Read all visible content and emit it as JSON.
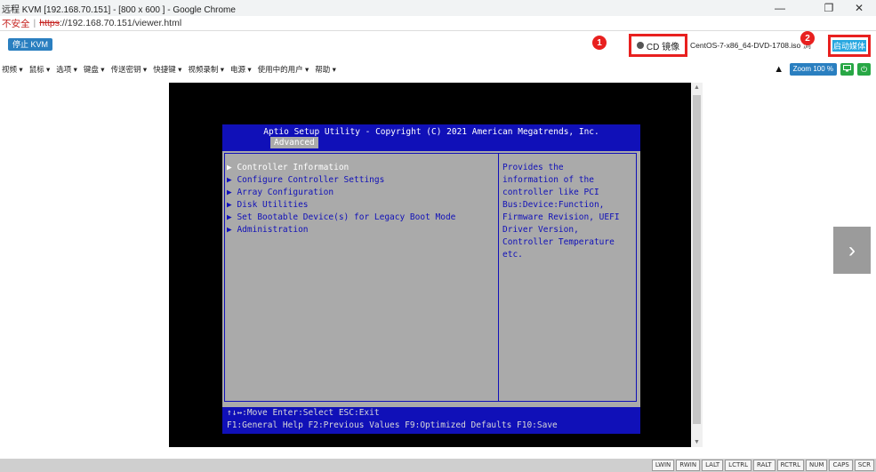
{
  "window": {
    "title": "远程 KVM [192.168.70.151] - [800 x 600 ] - Google Chrome",
    "minimize": "—",
    "maximize": "❐",
    "close": "✕"
  },
  "address": {
    "insecure": "不安全",
    "separator": "|",
    "scheme": "https",
    "rest": "://192.168.70.151/viewer.html"
  },
  "kvm_toolbar": {
    "stop_kvm": "停止 KVM",
    "cd_label": "CD 镜像",
    "iso_file": "CentOS-7-x86_64-DVD-1708.iso",
    "iso_tail": "浏",
    "start_media": "启动媒体",
    "badge_1": "1",
    "badge_2": "2"
  },
  "menu": {
    "items": [
      "视频 ▾",
      "鼠标 ▾",
      "选项 ▾",
      "键盘 ▾",
      "传送密钥 ▾",
      "快捷键 ▾",
      "视频录制 ▾",
      "电源 ▾",
      "使用中的用户 ▾",
      "帮助 ▾"
    ],
    "zoom": "Zoom 100 %",
    "warn_icon": "warning-icon",
    "monitor_icon": "monitor-icon",
    "power_icon": "power-icon"
  },
  "bios": {
    "title": "Aptio Setup Utility - Copyright (C) 2021 American Megatrends, Inc.",
    "tab": "Advanced",
    "items": [
      "Controller Information",
      "Configure Controller Settings",
      "Array Configuration",
      "Disk Utilities",
      "Set Bootable Device(s) for Legacy Boot Mode",
      "Administration"
    ],
    "help": [
      "Provides the",
      "information of the",
      "controller like PCI",
      "Bus:Device:Function,",
      "Firmware Revision, UEFI",
      "Driver Version,",
      "Controller Temperature",
      "etc."
    ],
    "footer_1": "↑↓↔:Move  Enter:Select  ESC:Exit",
    "footer_2": "F1:General Help  F2:Previous Values  F9:Optimized Defaults  F10:Save"
  },
  "viewer": {
    "next_arrow": "›"
  },
  "status_keys": [
    "LWIN",
    "RWIN",
    "LALT",
    "LCTRL",
    "RALT",
    "RCTRL",
    "NUM",
    "CAPS",
    "SCR"
  ]
}
